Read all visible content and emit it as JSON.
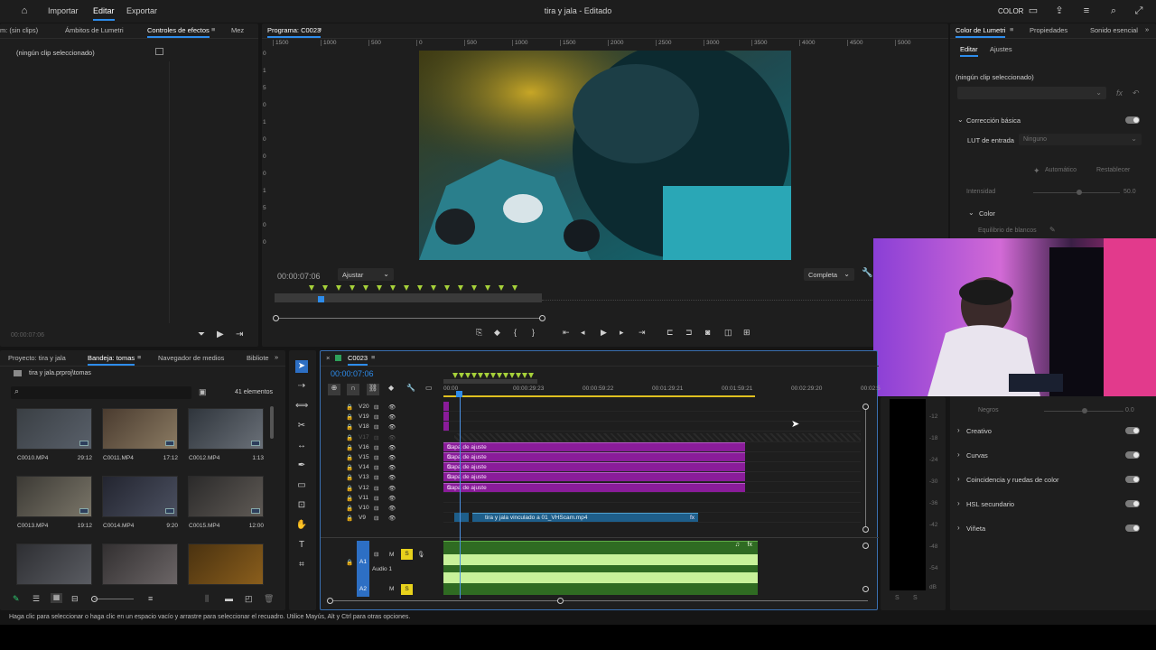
{
  "app": {
    "title": "tira y jala - Editado",
    "nav": [
      "Importar",
      "Editar",
      "Exportar"
    ],
    "active_nav": "Editar",
    "workspace": "COLOR"
  },
  "effects_panel": {
    "tabs": [
      "m: (sin clips)",
      "Ámbitos de Lumetri",
      "Controles de efectos",
      "Mez"
    ],
    "active": "Controles de efectos",
    "empty": "(ningún clip seleccionado)",
    "timecode": "00:00:07:06"
  },
  "program": {
    "title": "Programa: C0023",
    "ruler": [
      "1500",
      "1000",
      "500",
      "0",
      "500",
      "1000",
      "1500",
      "2000",
      "2500",
      "3000",
      "3500",
      "4000",
      "4500",
      "5000"
    ],
    "v_ruler": [
      "0",
      "1",
      "5",
      "0",
      "1",
      "0",
      "0",
      "0",
      "1",
      "5",
      "0",
      "0"
    ],
    "timecode": "00:00:07:06",
    "fit": "Ajustar",
    "quality": "Completa",
    "controls": [
      "lift-icon",
      "mark-icon",
      "in-icon",
      "out-icon",
      "goto-in-icon",
      "step-back-icon",
      "play-icon",
      "step-fwd-icon",
      "goto-out-icon",
      "insert-icon",
      "overwrite-icon",
      "camera-icon",
      "compare-icon",
      "vr-icon"
    ]
  },
  "lumetri": {
    "tabs": [
      "Color de Lumetri",
      "Propiedades",
      "Sonido esencial"
    ],
    "active": "Color de Lumetri",
    "subtabs": [
      "Editar",
      "Ajustes"
    ],
    "active_subtab": "Editar",
    "no_clip": "(ningún clip seleccionado)",
    "basic": "Corrección básica",
    "lut_label": "LUT de entrada",
    "lut_value": "Ninguno",
    "auto": "Automático",
    "reset": "Restablecer",
    "intensity": "Intensidad",
    "intensity_value": "50.0",
    "color": "Color",
    "wb": "Equilibrio de blancos",
    "blacks": "Negros",
    "blacks_value": "0.0",
    "sections": [
      "Creativo",
      "Curvas",
      "Coincidencia y ruedas de color",
      "HSL secundario",
      "Viñeta"
    ]
  },
  "project": {
    "tabs": [
      "Proyecto: tira y jala",
      "Bandeja: tomas",
      "Navegador de medios",
      "Bibliote"
    ],
    "active": "Bandeja: tomas",
    "path": "tira y jala.prproj\\tomas",
    "count": "41 elementos",
    "clips": [
      {
        "name": "C0010.MP4",
        "dur": "29:12",
        "c": [
          "#3a3f44",
          "#59606a"
        ]
      },
      {
        "name": "C0011.MP4",
        "dur": "17:12",
        "c": [
          "#4a3b2f",
          "#8a7a62"
        ]
      },
      {
        "name": "C0012.MP4",
        "dur": "1:13",
        "c": [
          "#2f353c",
          "#6a7078"
        ]
      },
      {
        "name": "C0013.MP4",
        "dur": "19:12",
        "c": [
          "#3c3a35",
          "#7a7568"
        ]
      },
      {
        "name": "C0014.MP4",
        "dur": "9:20",
        "c": [
          "#232530",
          "#4b5060"
        ]
      },
      {
        "name": "C0015.MP4",
        "dur": "12:00",
        "c": [
          "#2b2a2a",
          "#5f5a55"
        ]
      },
      {
        "name": "",
        "dur": "",
        "c": [
          "#2e2f33",
          "#5a5c62"
        ]
      },
      {
        "name": "",
        "dur": "",
        "c": [
          "#333031",
          "#6b6566"
        ]
      },
      {
        "name": "",
        "dur": "",
        "c": [
          "#4a3210",
          "#8a5e1c"
        ]
      }
    ]
  },
  "timeline": {
    "sequence": "C0023",
    "timecode": "00:00:07:06",
    "ruler": [
      "00:00",
      "00:00:29:23",
      "00:00:59:22",
      "00:01:29:21",
      "00:01:59:21",
      "00:02:29:20",
      "00:02:5"
    ],
    "video_tracks": [
      "V20",
      "V19",
      "V18",
      "V17",
      "V16",
      "V15",
      "V14",
      "V13",
      "V12",
      "V11",
      "V10",
      "V9"
    ],
    "adjust_label": "Capa de ajuste",
    "fx": "fx",
    "video_clip": "tira y jala vinculado a 01_VHScam.mp4",
    "audio": {
      "a1": "A1",
      "a1_name": "Audio 1",
      "a2": "A2",
      "m": "M",
      "s": "S"
    }
  },
  "meter": {
    "labels": [
      "-12",
      "-18",
      "-24",
      "-30",
      "-36",
      "-42",
      "-48",
      "-54",
      "dB"
    ],
    "ss": [
      "S",
      "S"
    ]
  },
  "status": "Haga clic para seleccionar o haga clic en un espacio vacío y arrastre para seleccionar el recuadro. Utilice Mayús, Alt y Ctrl para otras opciones."
}
